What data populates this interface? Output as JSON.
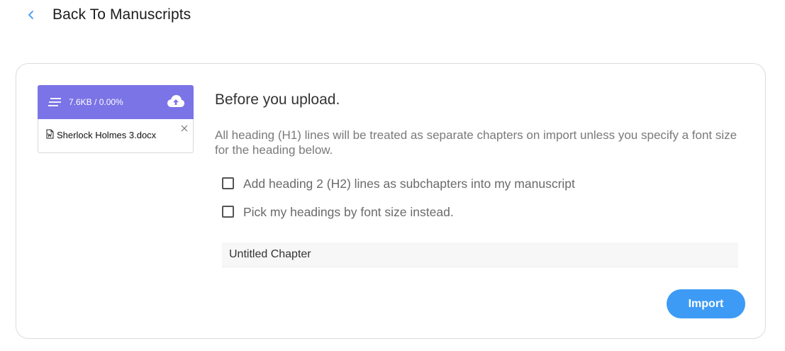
{
  "header": {
    "back_label": "Back To Manuscripts",
    "back_icon": "chevron-left-icon"
  },
  "file": {
    "progress_text": "7.6KB / 0.00%",
    "name": "Sherlock Holmes 3.docx",
    "header_color": "#7b74e6",
    "icons": [
      "menu-lines-icon",
      "cloud-upload-icon",
      "word-doc-icon",
      "close-icon"
    ]
  },
  "main": {
    "title": "Before you upload.",
    "description": "All heading (H1) lines will be treated as separate chapters on import unless you specify a font size for the heading below.",
    "options": [
      {
        "label": "Add heading 2 (H2) lines as subchapters into my manuscript",
        "checked": false
      },
      {
        "label": "Pick my headings by font size instead.",
        "checked": false
      }
    ],
    "chapter_input": {
      "value": "Untitled Chapter"
    },
    "import_label": "Import",
    "accent_color": "#3d9bf5"
  }
}
